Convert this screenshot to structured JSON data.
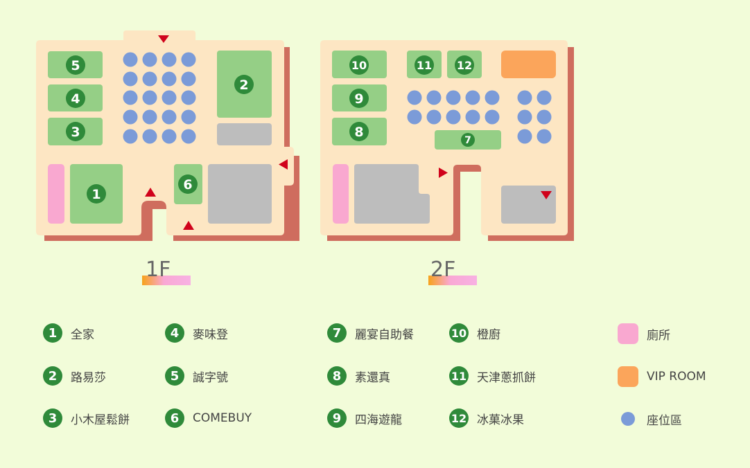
{
  "floors": [
    {
      "id": "1F",
      "label": "1F"
    },
    {
      "id": "2F",
      "label": "2F"
    }
  ],
  "map_numbers": {
    "n1": "1",
    "n2": "2",
    "n3": "3",
    "n4": "4",
    "n5": "5",
    "n6": "6",
    "n7": "7",
    "n8": "8",
    "n9": "9",
    "n10": "10",
    "n11": "11",
    "n12": "12"
  },
  "legend": {
    "col1": [
      {
        "num": "1",
        "label": "全家"
      },
      {
        "num": "2",
        "label": "路易莎"
      },
      {
        "num": "3",
        "label": "小木屋鬆餅"
      }
    ],
    "col2": [
      {
        "num": "4",
        "label": "麥味登"
      },
      {
        "num": "5",
        "label": "誠字號"
      },
      {
        "num": "6",
        "label": "COMEBUY"
      }
    ],
    "col3": [
      {
        "num": "7",
        "label": "麗宴自助餐"
      },
      {
        "num": "8",
        "label": "素還真"
      },
      {
        "num": "9",
        "label": "四海遊龍"
      }
    ],
    "col4": [
      {
        "num": "10",
        "label": "橙廚"
      },
      {
        "num": "11",
        "label": "天津蔥抓餅"
      },
      {
        "num": "12",
        "label": "冰菓冰果"
      }
    ],
    "types": [
      {
        "kind": "toilet",
        "label": "廁所"
      },
      {
        "kind": "vip",
        "label": "VIP ROOM"
      },
      {
        "kind": "seat",
        "label": "座位區"
      }
    ]
  },
  "colors": {
    "background": "#f2fcd9",
    "floor": "#fde6c3",
    "shadow": "#cf6d5e",
    "shop": "#95cf86",
    "badge": "#2f8a3a",
    "seat": "#7b9bd8",
    "toilet": "#f9a8d0",
    "vip": "#fba55b",
    "utility": "#bdbdbd",
    "entrance": "#d0021b"
  }
}
